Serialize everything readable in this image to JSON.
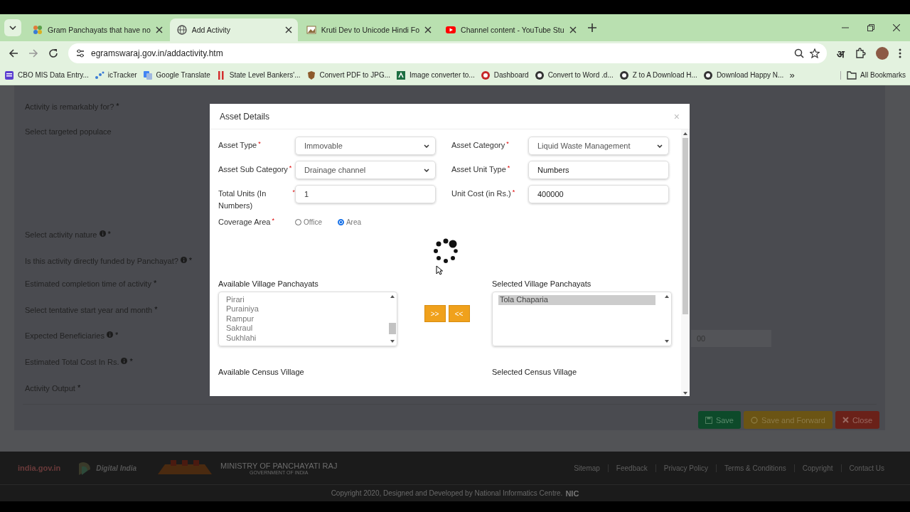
{
  "browser": {
    "tabs": [
      {
        "title": "Gram Panchayats that have no",
        "selected": false
      },
      {
        "title": "Add Activity",
        "selected": true
      },
      {
        "title": "Kruti Dev to Unicode Hindi Fo",
        "selected": false
      },
      {
        "title": "Channel content - YouTube Stu",
        "selected": false
      }
    ],
    "url": "egramswaraj.gov.in/addactivity.htm",
    "extension_letter": "अ",
    "bookmarks": [
      "CBO MIS Data Entry...",
      "icTracker",
      "Google Translate",
      "State Level Bankers'...",
      "Convert PDF to JPG...",
      "Image converter to...",
      "Dashboard",
      "Convert to Word .d...",
      "Z to A Download H...",
      "Download Happy N..."
    ],
    "more_bookmarks": "»",
    "all_bookmarks": "All Bookmarks"
  },
  "form": {
    "labels": [
      {
        "text": "Activity is remarkably for?",
        "info": false,
        "required": "*"
      },
      {
        "text": "Select targeted populace",
        "info": false
      },
      {
        "text": "Select activity nature",
        "info": true,
        "required": "*"
      },
      {
        "text": "Is this activity directly funded by Panchayat?",
        "info": true,
        "required": "*"
      },
      {
        "text": "Estimated completion time of activity",
        "info": false,
        "required": "*"
      },
      {
        "text": "Select tentative start year and month",
        "info": false,
        "required": "*"
      },
      {
        "text": "Expected Beneficiaries",
        "info": true,
        "required": "*"
      },
      {
        "text": "Estimated Total Cost In Rs.",
        "info": true,
        "required": "*"
      },
      {
        "text": "Activity Output",
        "info": false,
        "required": "*"
      }
    ],
    "cost_field_value": "00",
    "buttons": [
      {
        "kind": "save",
        "label": "Save"
      },
      {
        "kind": "forward",
        "label": "Save and Forward"
      },
      {
        "kind": "close",
        "label": "Close"
      }
    ]
  },
  "modal": {
    "title": "Asset Details",
    "close": "×",
    "fields": [
      {
        "label": "Asset Type",
        "required": "*",
        "kind": "select",
        "value": "Immovable"
      },
      {
        "label": "Asset Category",
        "required": "*",
        "kind": "select",
        "value": "Liquid Waste Management"
      },
      {
        "label": "Asset Sub Category",
        "required": "*",
        "kind": "select",
        "value": "Drainage channel"
      },
      {
        "label": "Asset Unit Type",
        "required": "*",
        "kind": "input",
        "value": "Numbers"
      },
      {
        "label": "Total Units (In Numbers)",
        "required": "*",
        "kind": "input",
        "value": "1"
      },
      {
        "label": "Unit Cost (in Rs.)",
        "required": "*",
        "kind": "input",
        "value": "400000"
      }
    ],
    "coverage": {
      "label": "Coverage Area",
      "required": "*",
      "options": [
        {
          "label": "Office",
          "selected": false
        },
        {
          "label": "Area",
          "selected": true
        }
      ]
    },
    "available_village_panchayats": {
      "label": "Available Village Panchayats",
      "items": [
        {
          "text": "Pirari",
          "selected": false
        },
        {
          "text": "Purainiya",
          "selected": false
        },
        {
          "text": "Rampur",
          "selected": false
        },
        {
          "text": "Sakraul",
          "selected": false
        },
        {
          "text": "Sukhlahi",
          "selected": false
        }
      ]
    },
    "move_buttons": [
      ">>",
      "<<"
    ],
    "selected_village_panchayats": {
      "label": "Selected Village Panchayats",
      "items": [
        {
          "text": "Tola Chaparia",
          "selected": true
        }
      ]
    },
    "available_census_village": {
      "label": "Available Census Village"
    },
    "selected_census_village": {
      "label": "Selected Census Village"
    }
  },
  "footer": {
    "ministry": "MINISTRY OF PANCHAYATI RAJ",
    "government": "GOVERNMENT OF INDIA",
    "digital_india": "Digital India",
    "india_gov": "india.gov.in",
    "links": [
      "Sitemap",
      "Feedback",
      "Privacy Policy",
      "Terms & Conditions",
      "Copyright",
      "Contact Us"
    ],
    "copyright": "Copyright 2020, Designed and Developed by National Informatics Centre.",
    "nic": "NIC"
  }
}
